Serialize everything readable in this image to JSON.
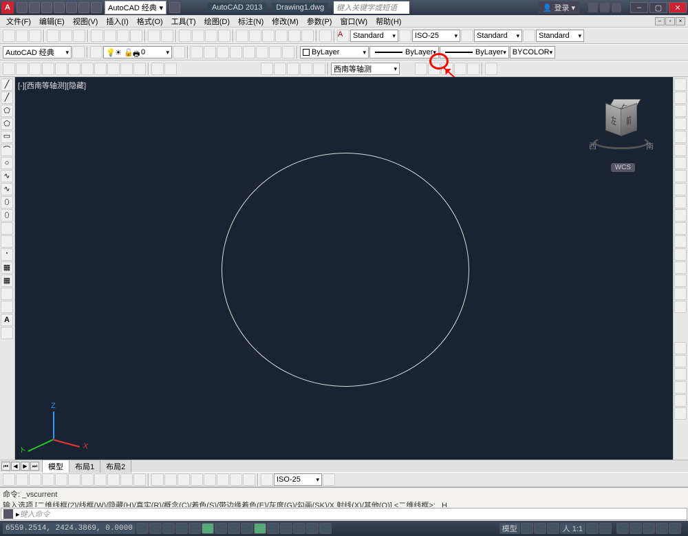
{
  "title": {
    "app": "AutoCAD 2013",
    "doc": "Drawing1.dwg",
    "workspace": "AutoCAD 经典",
    "search_placeholder": "键入关键字或短语",
    "login": "登录"
  },
  "menu": {
    "items": [
      "文件(F)",
      "编辑(E)",
      "视图(V)",
      "插入(I)",
      "格式(O)",
      "工具(T)",
      "绘图(D)",
      "标注(N)",
      "修改(M)",
      "参数(P)",
      "窗口(W)",
      "帮助(H)"
    ]
  },
  "styles_row": {
    "text_style": "Standard",
    "dim_style": "ISO-25",
    "table_style": "Standard",
    "mleader_style": "Standard"
  },
  "workspace_row": {
    "workspace": "AutoCAD 经典",
    "layer": "0",
    "linetype": "ByLayer",
    "lineweight": "ByLayer",
    "plot_style": "ByLayer",
    "color_label": "BYCOLOR"
  },
  "view_row": {
    "view_name": "西南等轴测"
  },
  "viewport": {
    "label": "[-][西南等轴测][隐藏]",
    "wcs": "WCS",
    "cube_top": "上",
    "cube_left": "左",
    "cube_front": "前",
    "ring_w": "西",
    "ring_s": "南"
  },
  "layout": {
    "tabs": [
      "模型",
      "布局1",
      "布局2"
    ]
  },
  "dim_row": {
    "dim_style": "ISO-25"
  },
  "command": {
    "line1": "命令: _vscurrent",
    "line2": "输入选项 [二维线框(2)/线框(W)/隐藏(H)/真实(R)/概念(C)/着色(S)/带边缘着色(E)/灰度(G)/勾画(SK)/X 射线(X)/其他(O)] <二维线框>: _H",
    "placeholder": "键入命令"
  },
  "status": {
    "coords": "6559.2514, 2424.3869, 0.0000",
    "mode": "模型",
    "scale": "人 1:1",
    "anno": "人"
  }
}
